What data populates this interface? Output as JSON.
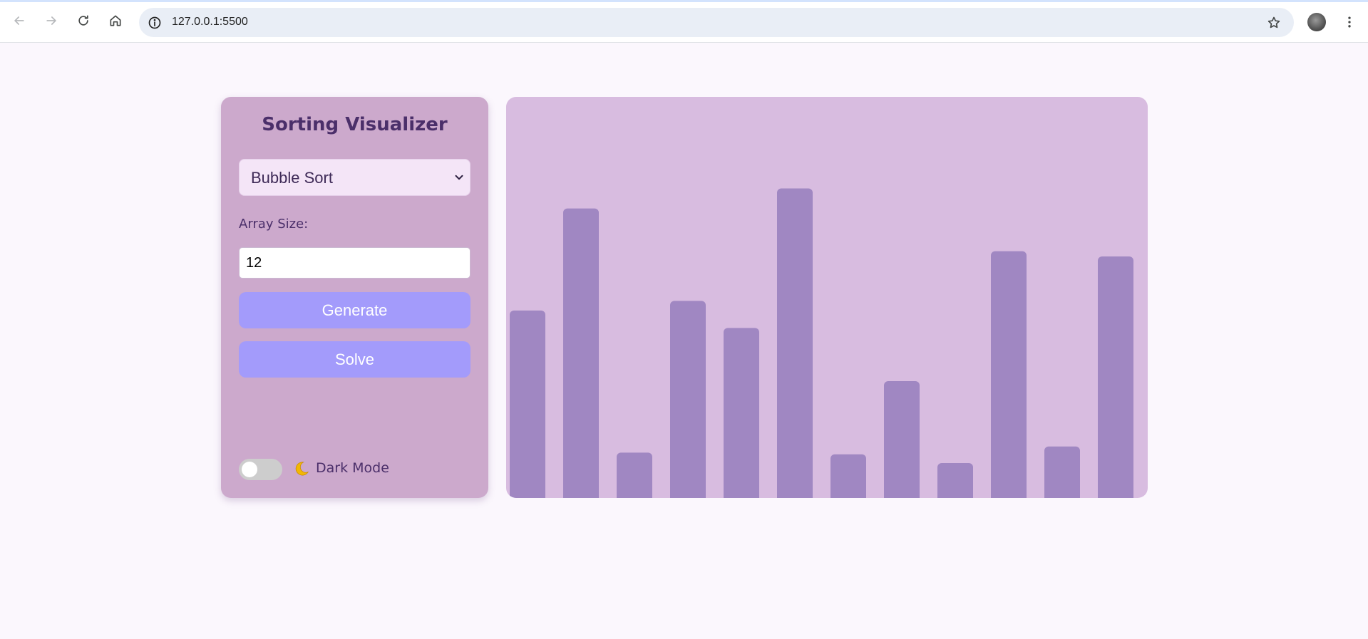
{
  "browser": {
    "url": "127.0.0.1:5500",
    "icons": [
      "back-arrow-icon",
      "forward-arrow-icon",
      "reload-icon",
      "home-icon",
      "site-info-icon",
      "bookmark-star-icon",
      "profile-avatar",
      "kebab-menu-icon"
    ]
  },
  "app": {
    "title": "Sorting Visualizer",
    "algorithm": {
      "selected": "Bubble Sort"
    },
    "array_size_label": "Array Size:",
    "array_size_value": "12",
    "generate_label": "Generate",
    "solve_label": "Solve",
    "dark_mode": {
      "label": "Dark Mode",
      "enabled": false,
      "icon": "crescent-moon-icon"
    }
  },
  "colors": {
    "page_background": "#fbf7fd",
    "panel_background": "#cca9cc",
    "visualizer_background": "#d8bce0",
    "bar": "#a087c2",
    "button": "#a39bfb",
    "title_text": "#4b2f6a"
  },
  "chart_data": {
    "type": "bar",
    "values": [
      215,
      332,
      52,
      226,
      195,
      355,
      50,
      134,
      40,
      283,
      59,
      277
    ],
    "ylim": [
      0,
      460
    ],
    "grid": false
  }
}
